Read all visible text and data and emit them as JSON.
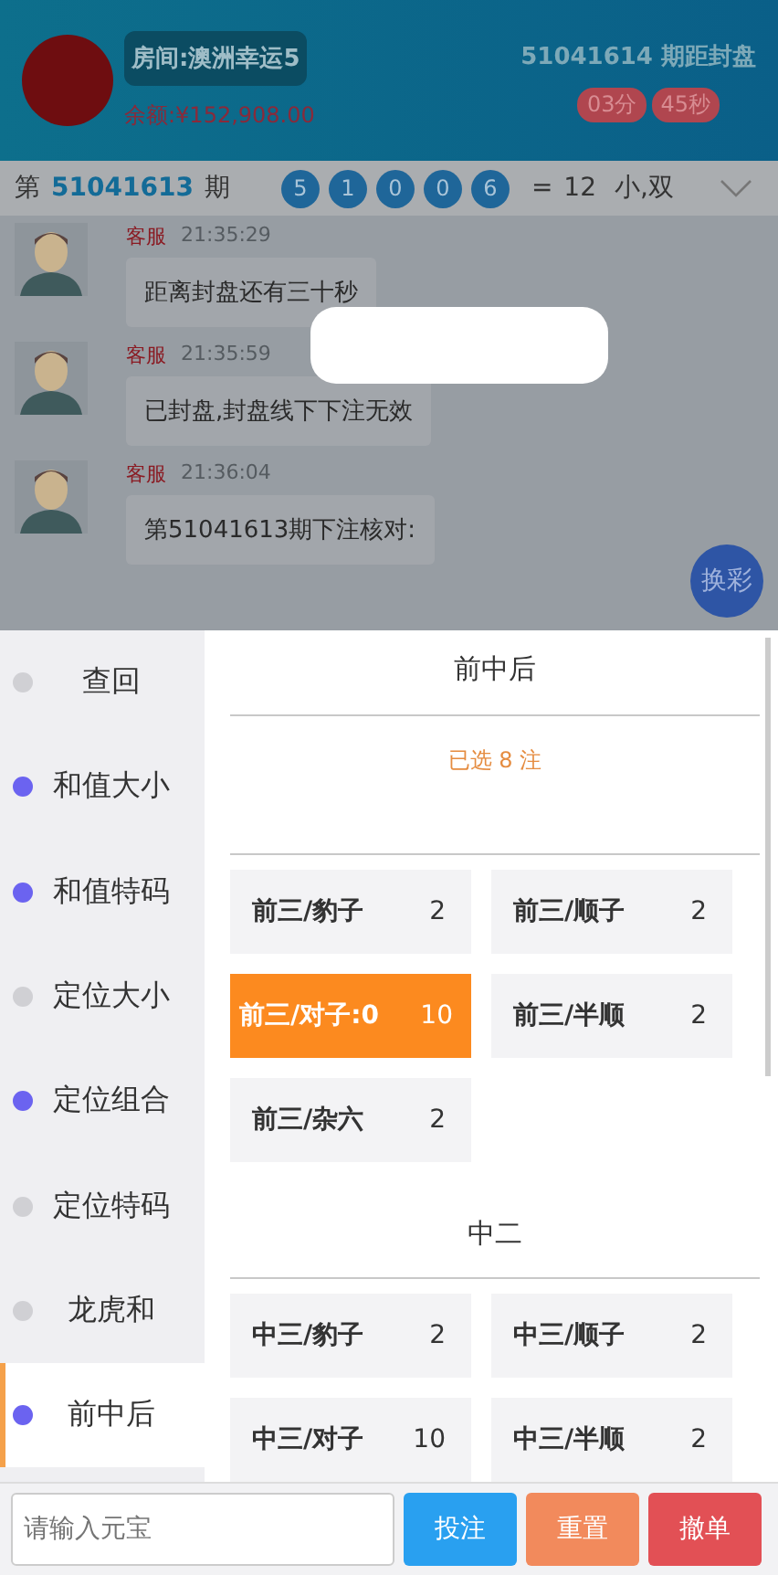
{
  "header": {
    "room": "房间:澳洲幸运5",
    "balance": "余额:¥152,908.00",
    "next_issue": "51041614 期距封盘",
    "countdown": [
      "03分",
      "45秒"
    ]
  },
  "result_bar": {
    "prefix": "第",
    "issue": "51041613",
    "suffix": "期",
    "balls": [
      "5",
      "1",
      "0",
      "0",
      "6"
    ],
    "equals": "=",
    "sum": "12",
    "tags": "小,双"
  },
  "messages": [
    {
      "sender": "客服",
      "time": "21:35:29",
      "text": "距离封盘还有三十秒"
    },
    {
      "sender": "客服",
      "time": "21:35:59",
      "text": "已封盘,封盘线下下注无效"
    },
    {
      "sender": "客服",
      "time": "21:36:04",
      "text": "第51041613期下注核对:"
    }
  ],
  "switch_button": "换彩",
  "sidebar": {
    "items": [
      {
        "label": "查回",
        "selected": false,
        "color": "#d0d0d4"
      },
      {
        "label": "和值大小",
        "selected": false,
        "color": "#6b63f0"
      },
      {
        "label": "和值特码",
        "selected": false,
        "color": "#6b63f0"
      },
      {
        "label": "定位大小",
        "selected": false,
        "color": "#d0d0d4"
      },
      {
        "label": "定位组合",
        "selected": false,
        "color": "#6b63f0"
      },
      {
        "label": "定位特码",
        "selected": false,
        "color": "#d0d0d4"
      },
      {
        "label": "龙虎和",
        "selected": false,
        "color": "#d0d0d4"
      },
      {
        "label": "前中后",
        "selected": true,
        "color": "#6b63f0"
      }
    ]
  },
  "panel": {
    "title": "前中后",
    "selected_count": "已选 8 注",
    "groups": [
      {
        "options": [
          {
            "label": "前三/豹子",
            "odds": "2",
            "selected": false
          },
          {
            "label": "前三/顺子",
            "odds": "2",
            "selected": false
          },
          {
            "label": "前三/对子:0",
            "odds": "10",
            "selected": true
          },
          {
            "label": "前三/半顺",
            "odds": "2",
            "selected": false
          },
          {
            "label": "前三/杂六",
            "odds": "2",
            "selected": false
          }
        ]
      },
      {
        "title": "中二",
        "options": [
          {
            "label": "中三/豹子",
            "odds": "2",
            "selected": false
          },
          {
            "label": "中三/顺子",
            "odds": "2",
            "selected": false
          },
          {
            "label": "中三/对子",
            "odds": "10",
            "selected": false
          },
          {
            "label": "中三/半顺",
            "odds": "2",
            "selected": false
          }
        ]
      }
    ]
  },
  "footer": {
    "amount_placeholder": "请输入元宝",
    "bet_button": "投注",
    "reset_button": "重置",
    "cancel_button": "撤单"
  }
}
